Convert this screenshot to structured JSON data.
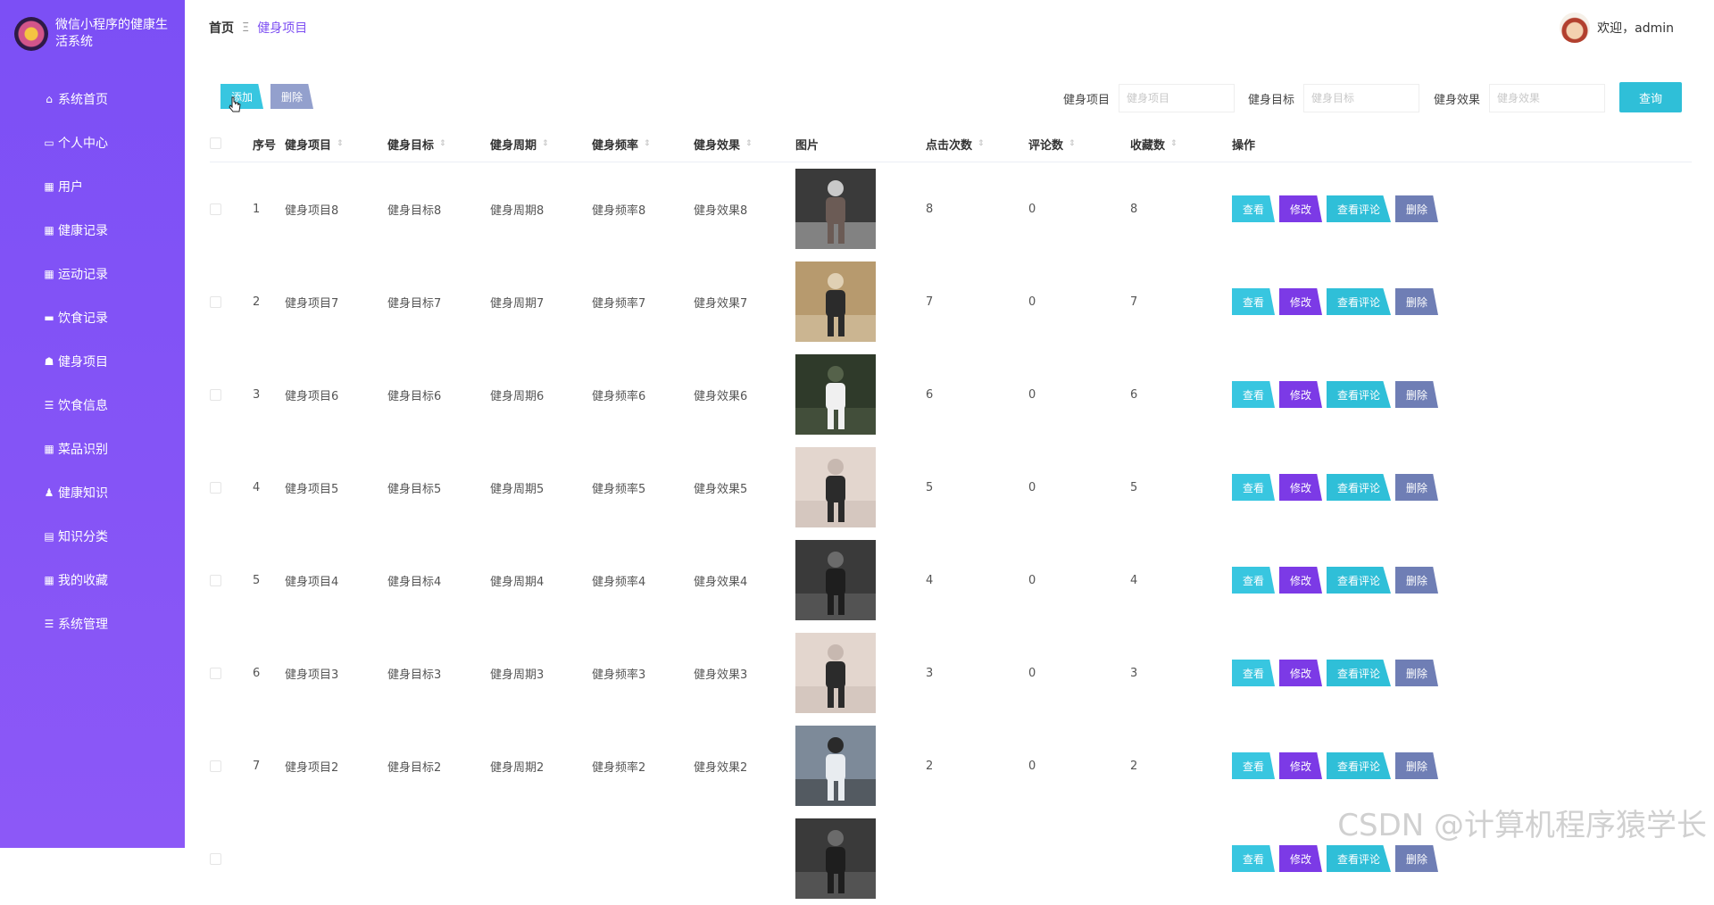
{
  "app": {
    "title": "微信小程序的健康生活系统"
  },
  "sidebar": {
    "items": [
      {
        "label": "系统首页",
        "icon": "home-icon"
      },
      {
        "label": "个人中心",
        "icon": "id-card-icon"
      },
      {
        "label": "用户",
        "icon": "grid-icon"
      },
      {
        "label": "健康记录",
        "icon": "grid-icon"
      },
      {
        "label": "运动记录",
        "icon": "grid-icon"
      },
      {
        "label": "饮食记录",
        "icon": "monitor-icon"
      },
      {
        "label": "健身项目",
        "icon": "house-icon"
      },
      {
        "label": "饮食信息",
        "icon": "list-icon"
      },
      {
        "label": "菜品识别",
        "icon": "grid-icon"
      },
      {
        "label": "健康知识",
        "icon": "person-icon"
      },
      {
        "label": "知识分类",
        "icon": "clipboard-icon"
      },
      {
        "label": "我的收藏",
        "icon": "grid-icon"
      },
      {
        "label": "系统管理",
        "icon": "list-icon"
      }
    ]
  },
  "header": {
    "breadcrumb": {
      "home": "首页",
      "separator": "Ξ",
      "current": "健身项目"
    },
    "welcome": "欢迎，admin"
  },
  "toolbar": {
    "add_label": "添加",
    "delete_label": "删除",
    "search_fields": [
      {
        "label": "健身项目",
        "placeholder": "健身项目"
      },
      {
        "label": "健身目标",
        "placeholder": "健身目标"
      },
      {
        "label": "健身效果",
        "placeholder": "健身效果"
      }
    ],
    "search_label": "查询"
  },
  "table": {
    "columns": [
      "序号",
      "健身项目",
      "健身目标",
      "健身周期",
      "健身频率",
      "健身效果",
      "图片",
      "点击次数",
      "评论数",
      "收藏数",
      "操作"
    ],
    "rows": [
      {
        "index": "1",
        "project": "健身项目8",
        "goal": "健身目标8",
        "cycle": "健身周期8",
        "frequency": "健身频率8",
        "effect": "健身效果8",
        "clicks": "8",
        "comments": "0",
        "favorites": "8",
        "thumb": "dark"
      },
      {
        "index": "2",
        "project": "健身项目7",
        "goal": "健身目标7",
        "cycle": "健身周期7",
        "frequency": "健身频率7",
        "effect": "健身效果7",
        "clicks": "7",
        "comments": "0",
        "favorites": "7",
        "thumb": "gym"
      },
      {
        "index": "3",
        "project": "健身项目6",
        "goal": "健身目标6",
        "cycle": "健身周期6",
        "frequency": "健身频率6",
        "effect": "健身效果6",
        "clicks": "6",
        "comments": "0",
        "favorites": "6",
        "thumb": "outdoor"
      },
      {
        "index": "4",
        "project": "健身项目5",
        "goal": "健身目标5",
        "cycle": "健身周期5",
        "frequency": "健身频率5",
        "effect": "健身效果5",
        "clicks": "5",
        "comments": "0",
        "favorites": "5",
        "thumb": "light"
      },
      {
        "index": "5",
        "project": "健身项目4",
        "goal": "健身目标4",
        "cycle": "健身周期4",
        "frequency": "健身频率4",
        "effect": "健身效果4",
        "clicks": "4",
        "comments": "0",
        "favorites": "4",
        "thumb": "studio"
      },
      {
        "index": "6",
        "project": "健身项目3",
        "goal": "健身目标3",
        "cycle": "健身周期3",
        "frequency": "健身频率3",
        "effect": "健身效果3",
        "clicks": "3",
        "comments": "0",
        "favorites": "3",
        "thumb": "light"
      },
      {
        "index": "7",
        "project": "健身项目2",
        "goal": "健身目标2",
        "cycle": "健身周期2",
        "frequency": "健身频率2",
        "effect": "健身效果2",
        "clicks": "2",
        "comments": "0",
        "favorites": "2",
        "thumb": "hall"
      },
      {
        "index": "",
        "project": "",
        "goal": "",
        "cycle": "",
        "frequency": "",
        "effect": "",
        "clicks": "",
        "comments": "",
        "favorites": "",
        "thumb": "studio"
      }
    ],
    "ops": {
      "view": "查看",
      "edit": "修改",
      "comments": "查看评论",
      "delete": "删除"
    }
  },
  "watermark": "CSDN @计算机程序猿学长",
  "colors": {
    "sidebar": "#8053f6",
    "accent": "#7d4ff2",
    "button_cyan": "#38c6e0",
    "button_purple": "#7c3ae6",
    "button_grey": "#93a0cd"
  }
}
